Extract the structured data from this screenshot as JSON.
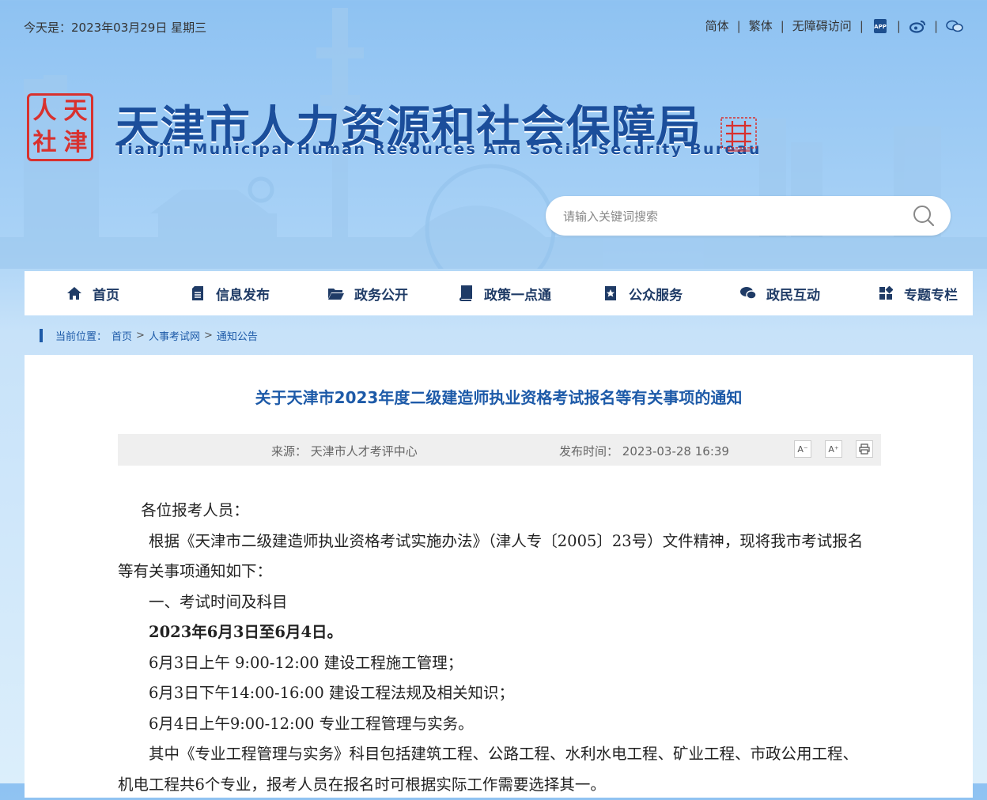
{
  "topbar": {
    "date": "今天是：2023年03月29日 星期三",
    "links": [
      "简体",
      "繁体",
      "无障碍访问"
    ],
    "icons": [
      "app-icon",
      "weibo-icon",
      "wechat-icon"
    ]
  },
  "header": {
    "seal_chars": [
      "人",
      "天",
      "社",
      "津"
    ],
    "title_cn": "天津市人力资源和社会保障局",
    "title_en": "Tianjin Municipal Human Resources And Social Security Bureau"
  },
  "search": {
    "placeholder": "请输入关键词搜索"
  },
  "nav": [
    {
      "label": "首页",
      "icon": "home-icon"
    },
    {
      "label": "信息发布",
      "icon": "document-icon"
    },
    {
      "label": "政务公开",
      "icon": "folder-icon"
    },
    {
      "label": "政策一点通",
      "icon": "book-icon"
    },
    {
      "label": "公众服务",
      "icon": "bookmark-star-icon"
    },
    {
      "label": "政民互动",
      "icon": "chat-icon"
    },
    {
      "label": "专题专栏",
      "icon": "grid-icon"
    }
  ],
  "breadcrumb": {
    "label": "当前位置：",
    "items": [
      "首页",
      "人事考试网",
      "通知公告"
    ]
  },
  "article": {
    "title": "关于天津市2023年度二级建造师执业资格考试报名等有关事项的通知",
    "source_label": "来源：",
    "source": "天津市人才考评中心",
    "time_label": "发布时间：",
    "time": "2023-03-28 16:39",
    "tools": {
      "font_smaller": "A⁻",
      "font_larger": "A⁺"
    },
    "paragraphs": [
      "各位报考人员：",
      "根据《天津市二级建造师执业资格考试实施办法》（津人专〔2005〕23号）文件精神，现将我市考试报名等有关事项通知如下：",
      "一、考试时间及科目",
      "2023年6月3日至6月4日。",
      "6月3日上午 9:00-12:00 建设工程施工管理；",
      "6月3日下午14:00-16:00 建设工程法规及相关知识；",
      "6月4日上午9:00-12:00 专业工程管理与实务。",
      "其中《专业工程管理与实务》科目包括建筑工程、公路工程、水利水电工程、矿业工程、市政公用工程、机电工程共6个专业，报考人员在报名时可根据实际工作需要选择其一。"
    ]
  }
}
